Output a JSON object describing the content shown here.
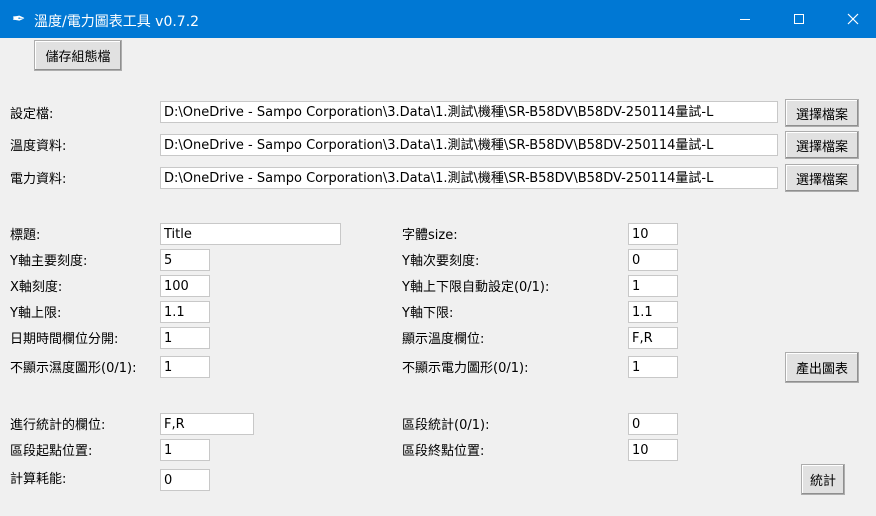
{
  "window": {
    "title": "溫度/電力圖表工具 v0.7.2"
  },
  "toolbar": {
    "save_config_label": "儲存組態檔"
  },
  "files": {
    "config_label": "設定檔:",
    "config_path": "D:\\OneDrive - Sampo Corporation\\3.Data\\1.測試\\機種\\SR-B58DV\\B58DV-250114量試-L",
    "temp_label": "溫度資料:",
    "temp_path": "D:\\OneDrive - Sampo Corporation\\3.Data\\1.測試\\機種\\SR-B58DV\\B58DV-250114量試-L",
    "power_label": "電力資料:",
    "power_path": "D:\\OneDrive - Sampo Corporation\\3.Data\\1.測試\\機種\\SR-B58DV\\B58DV-250114量試-L",
    "browse_label": "選擇檔案"
  },
  "params": {
    "title_label": "標題:",
    "title_value": "Title",
    "y_major_label": "Y軸主要刻度:",
    "y_major_value": "5",
    "x_tick_label": "X軸刻度:",
    "x_tick_value": "100",
    "y_max_label": "Y軸上限:",
    "y_max_value": "1.1",
    "datetime_sep_label": "日期時間欄位分開:",
    "datetime_sep_value": "1",
    "hide_temp_label": "不顯示濕度圖形(0/1):",
    "hide_temp_value": "1",
    "font_size_label": "字體size:",
    "font_size_value": "10",
    "y_minor_label": "Y軸次要刻度:",
    "y_minor_value": "0",
    "y_auto_label": "Y軸上下限自動設定(0/1):",
    "y_auto_value": "1",
    "y_min_label": "Y軸下限:",
    "y_min_value": "1.1",
    "show_temp_cols_label": "顯示溫度欄位:",
    "show_temp_cols_value": "F,R",
    "hide_power_label": "不顯示電力圖形(0/1):",
    "hide_power_value": "1",
    "export_chart_label": "產出圖表"
  },
  "stats": {
    "stat_cols_label": "進行統計的欄位:",
    "stat_cols_value": "F,R",
    "seg_start_label": "區段起點位置:",
    "seg_start_value": "1",
    "calc_energy_label": "計算耗能:",
    "calc_energy_value": "0",
    "seg_stat_label": "區段統計(0/1):",
    "seg_stat_value": "0",
    "seg_end_label": "區段終點位置:",
    "seg_end_value": "10",
    "stat_button_label": "統計"
  }
}
